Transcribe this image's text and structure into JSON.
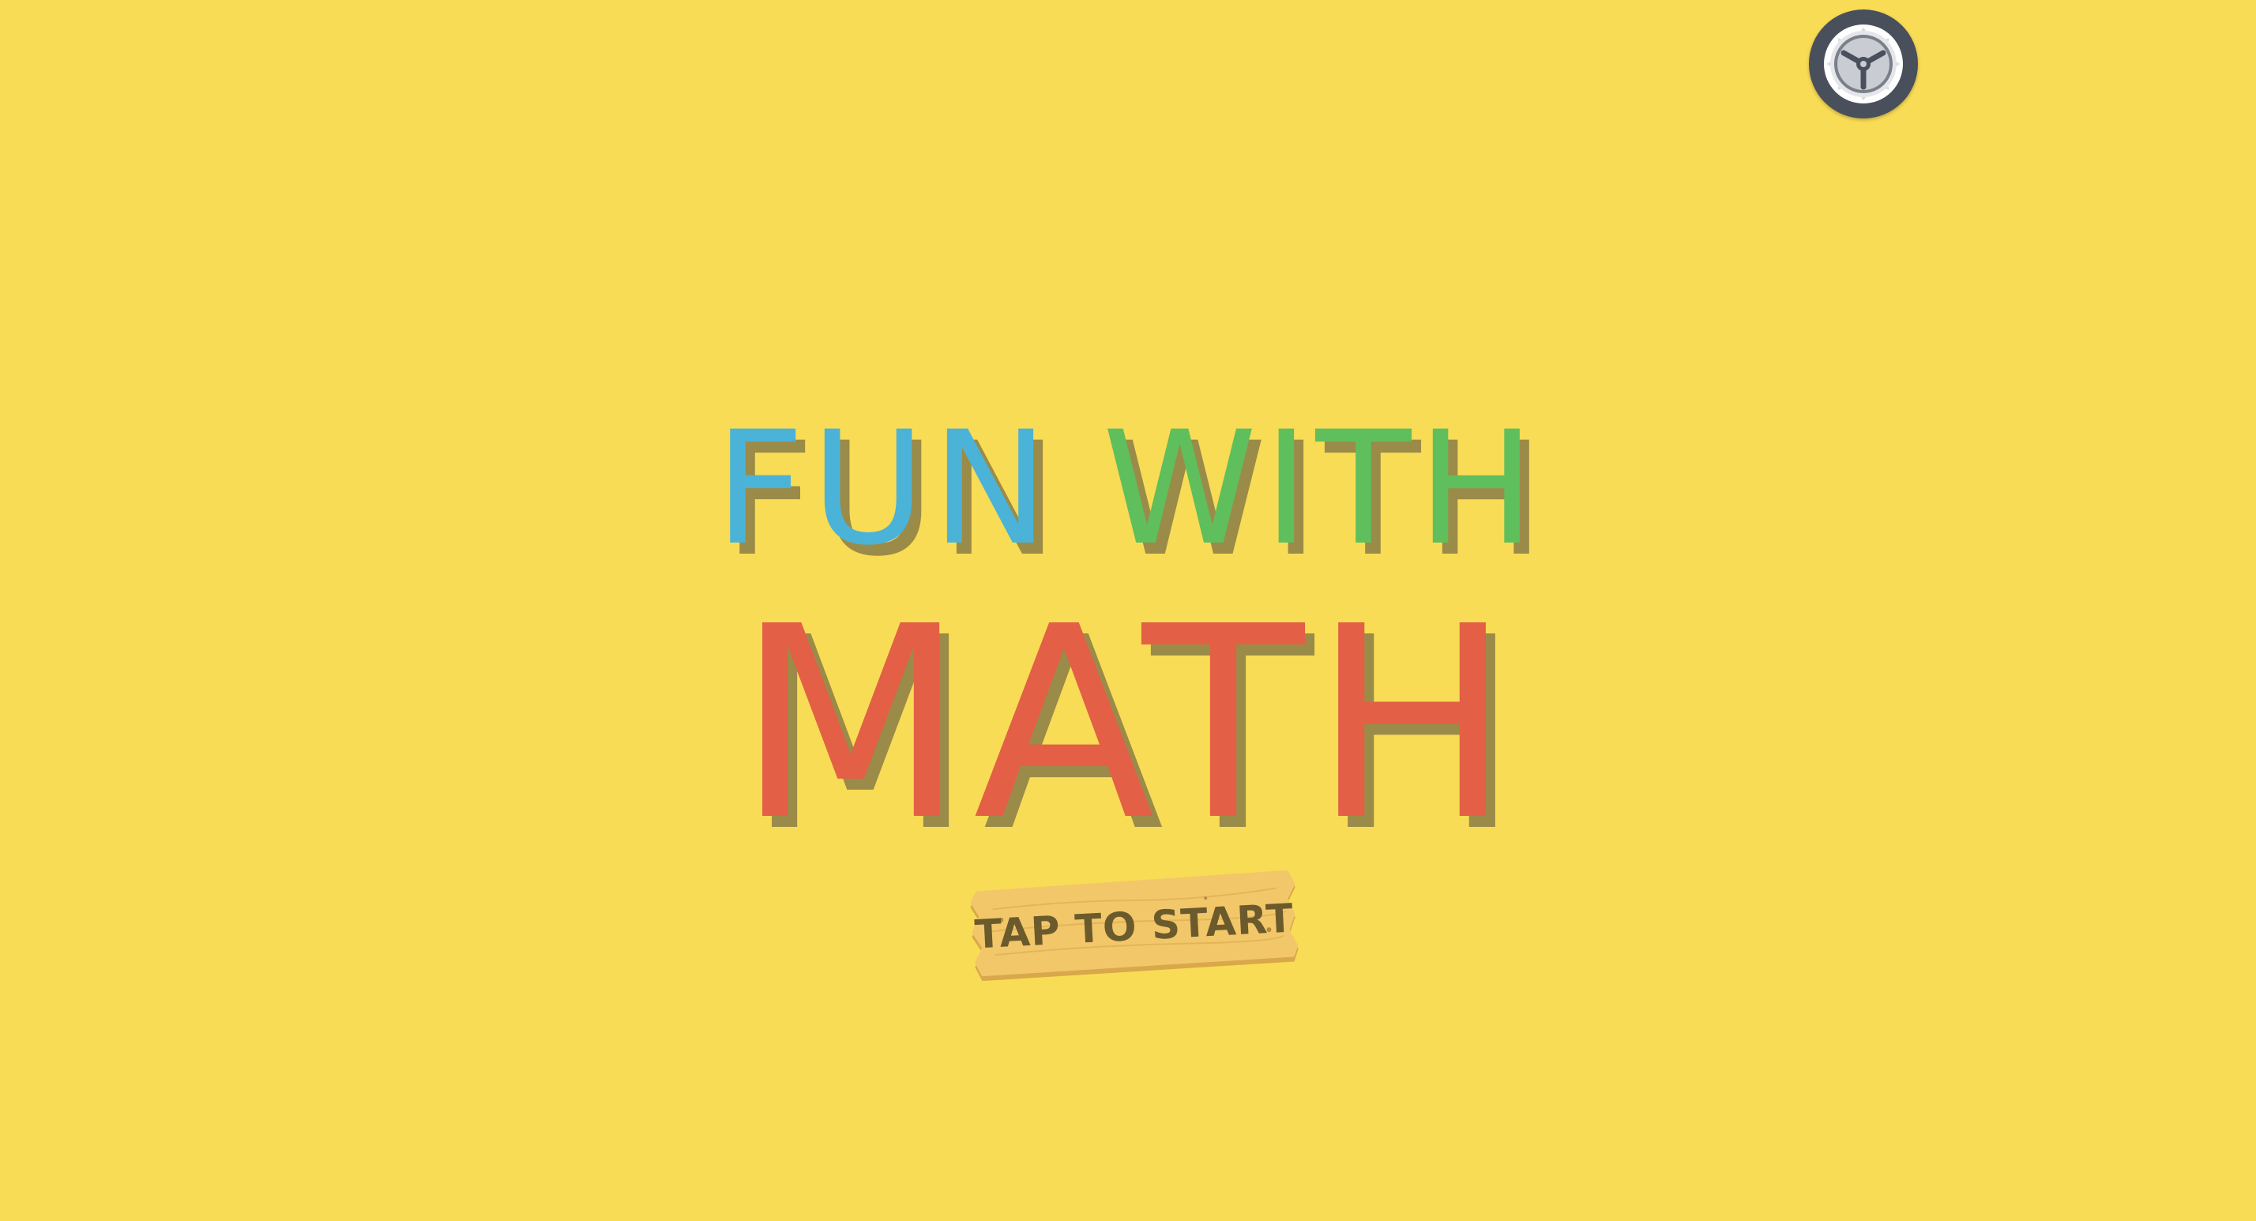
{
  "title": {
    "word1": "FUN",
    "word2": "WITH",
    "word3": "MATH"
  },
  "start_label": "TAP TO START",
  "icons": {
    "settings": "gear-icon"
  },
  "colors": {
    "background": "#f9dc55",
    "word1": "#4bb3d8",
    "word2": "#5fbf5c",
    "word3": "#e35f45",
    "shadow": "#9b8b48",
    "settings_bg": "#4a4f5c",
    "sign_wood": "#f2c76a",
    "sign_text": "#6b5a2c"
  }
}
